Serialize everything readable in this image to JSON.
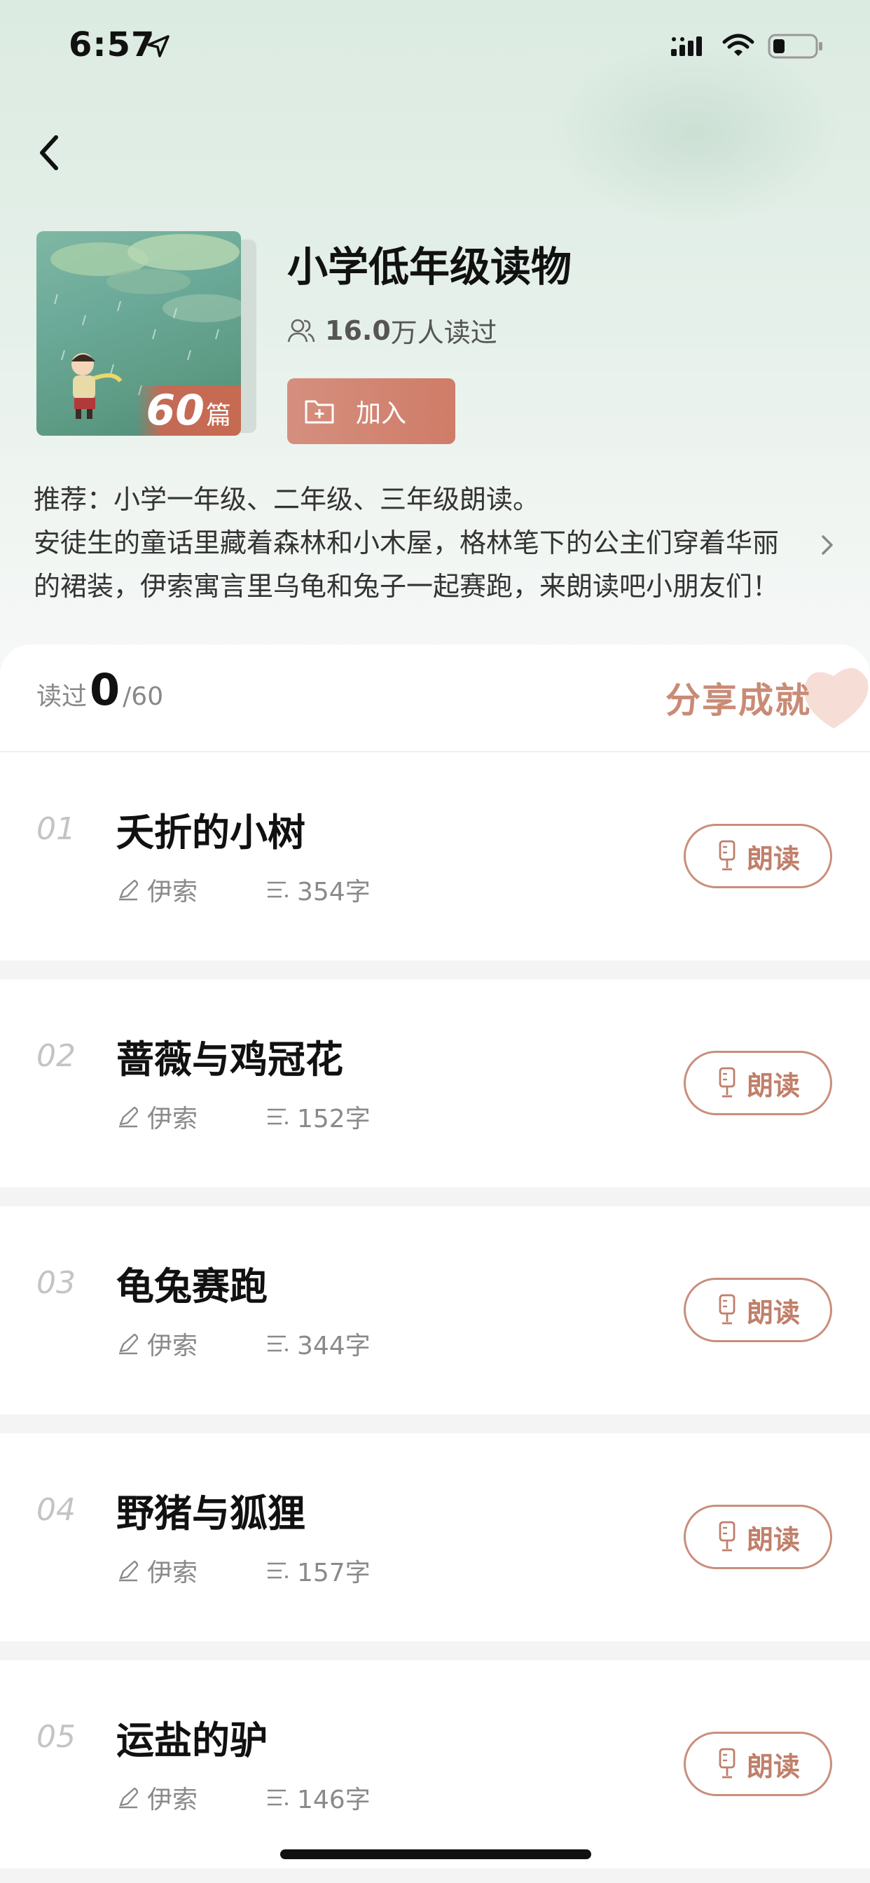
{
  "status_bar": {
    "time": "6:57"
  },
  "book": {
    "title": "小学低年级读物",
    "reader_count": "16.0",
    "reader_label": "万人读过",
    "cover_count": "60",
    "cover_unit": "篇",
    "add_label": "加入",
    "description_line1": "推荐：小学一年级、二年级、三年级朗读。",
    "description_line2": "安徒生的童话里藏着森林和小木屋，格林笔下的公主们穿着华丽",
    "description_line3": "的裙装，伊索寓言里乌龟和兔子一起赛跑，来朗读吧小朋友们！"
  },
  "progress": {
    "prefix": "读过",
    "current": "0",
    "total": "/60",
    "share_label": "分享成就"
  },
  "items": [
    {
      "index": "01",
      "title": "夭折的小树",
      "author": "伊索",
      "words": "354字",
      "action": "朗读"
    },
    {
      "index": "02",
      "title": "蔷薇与鸡冠花",
      "author": "伊索",
      "words": "152字",
      "action": "朗读"
    },
    {
      "index": "03",
      "title": "龟兔赛跑",
      "author": "伊索",
      "words": "344字",
      "action": "朗读"
    },
    {
      "index": "04",
      "title": "野猪与狐狸",
      "author": "伊索",
      "words": "157字",
      "action": "朗读"
    },
    {
      "index": "05",
      "title": "运盐的驴",
      "author": "伊索",
      "words": "146字",
      "action": "朗读"
    }
  ],
  "colors": {
    "accent": "#c98e7b",
    "add_button": "#d58f7e",
    "hero_bg": "#dcebe2"
  }
}
